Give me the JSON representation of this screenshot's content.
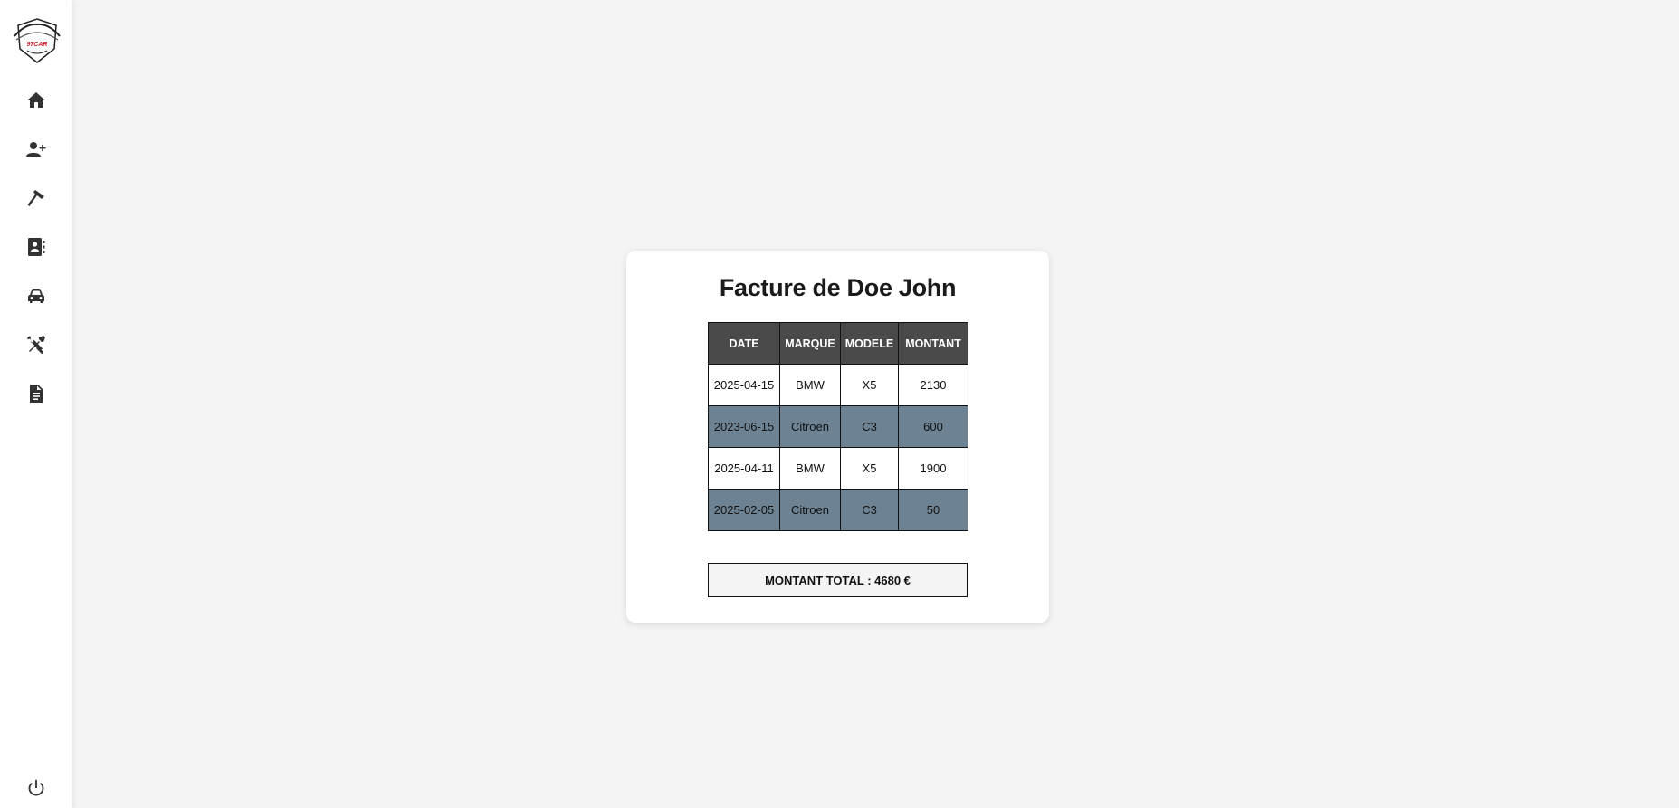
{
  "sidebar": {
    "logo_text": "97CAR",
    "items": [
      {
        "icon": "home-icon"
      },
      {
        "icon": "add-user-icon"
      },
      {
        "icon": "hammer-icon"
      },
      {
        "icon": "contacts-icon"
      },
      {
        "icon": "car-icon"
      },
      {
        "icon": "tools-icon"
      },
      {
        "icon": "invoice-icon"
      }
    ],
    "logout_icon": "power-icon"
  },
  "invoice": {
    "title": "Facture de Doe John",
    "columns": [
      "DATE",
      "MARQUE",
      "MODELE",
      "MONTANT"
    ],
    "rows": [
      {
        "date": "2025-04-15",
        "marque": "BMW",
        "modele": "X5",
        "montant": "2130"
      },
      {
        "date": "2023-06-15",
        "marque": "Citroen",
        "modele": "C3",
        "montant": "600"
      },
      {
        "date": "2025-04-11",
        "marque": "BMW",
        "modele": "X5",
        "montant": "1900"
      },
      {
        "date": "2025-02-05",
        "marque": "Citroen",
        "modele": "C3",
        "montant": "50"
      }
    ],
    "total": "MONTANT TOTAL : 4680 €"
  },
  "colors": {
    "header_bg": "#4a4a4a",
    "striped_row": "#6d8394",
    "page_bg": "#f4f4f4"
  }
}
